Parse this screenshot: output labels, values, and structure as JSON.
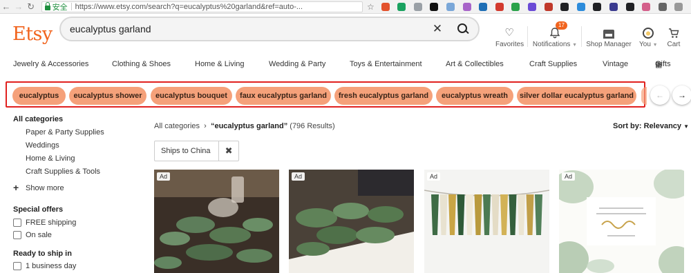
{
  "browser": {
    "secure_label": "安全",
    "url": "https://www.etsy.com/search?q=eucalyptus%20garland&ref=auto-...",
    "extensions": [
      "#e3522d",
      "#1aa260",
      "#9aa0a6",
      "#111111",
      "#7aa7d8",
      "#a865c9",
      "#1f6fb5",
      "#d23a2e",
      "#2aa24a",
      "#6b4bd6",
      "#c0392b",
      "#202124",
      "#2d8cdb",
      "#202124",
      "#3b3b8f",
      "#202124",
      "#d45f8a",
      "#666666",
      "#999999"
    ]
  },
  "header": {
    "logo": "Etsy",
    "search_value": "eucalyptus garland",
    "favorites": "Favorites",
    "notifications": "Notifications",
    "notifications_count": "17",
    "shop_manager": "Shop Manager",
    "you": "You",
    "cart": "Cart",
    "brand_color": "#f1641e"
  },
  "categories": [
    "Jewelry & Accessories",
    "Clothing & Shoes",
    "Home & Living",
    "Wedding & Party",
    "Toys & Entertainment",
    "Art & Collectibles",
    "Craft Supplies",
    "Vintage",
    "Gifts"
  ],
  "related_searches": [
    "eucalyptus",
    "eucalyptus shower",
    "eucalyptus bouquet",
    "faux eucalyptus garland",
    "fresh eucalyptus garland",
    "eucalyptus wreath",
    "silver dollar eucalyptus garland"
  ],
  "sidebar": {
    "all_categories": "All categories",
    "subcategories": [
      "Paper & Party Supplies",
      "Weddings",
      "Home & Living",
      "Craft Supplies & Tools"
    ],
    "show_more": "Show more",
    "special_offers": "Special offers",
    "offers": [
      "FREE shipping",
      "On sale"
    ],
    "ready_to_ship": "Ready to ship in",
    "ship_options": [
      "1 business day"
    ]
  },
  "results": {
    "crumb_root": "All categories",
    "query": "“eucalyptus garland”",
    "count": "(796 Results)",
    "sort_by": "Sort by: Relevancy",
    "filter_chip": "Ships to China",
    "ad_label": "Ad"
  }
}
